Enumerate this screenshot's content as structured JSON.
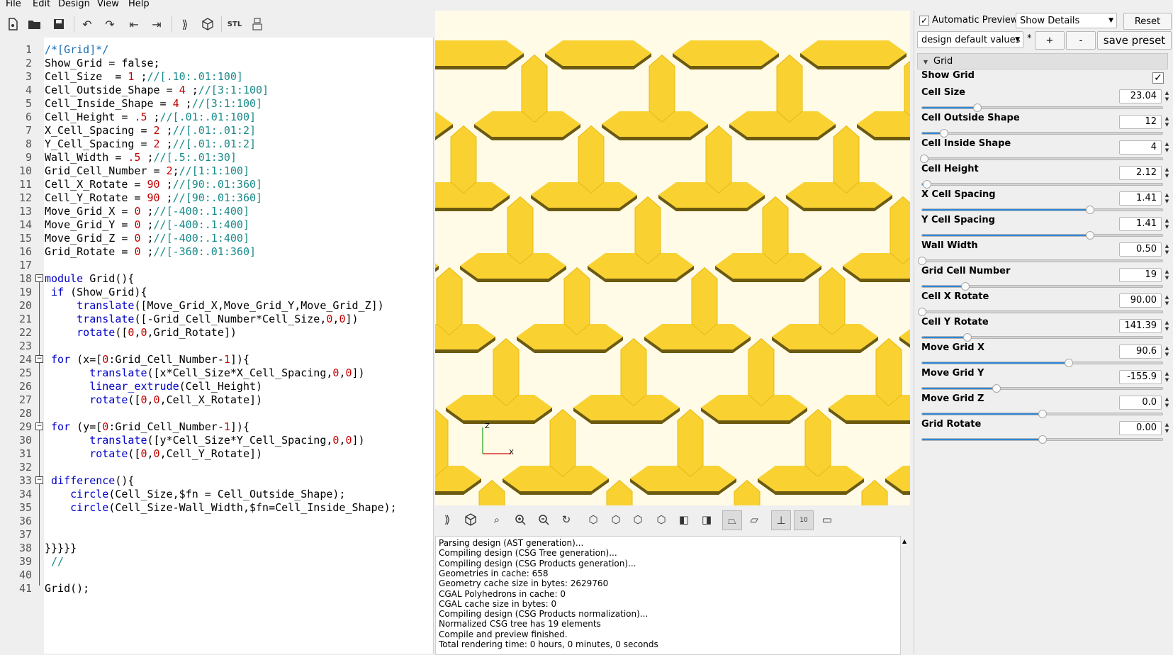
{
  "menubar": {
    "items": [
      "File",
      "Edit",
      "Design",
      "View",
      "Help"
    ]
  },
  "toolbar": {
    "icons": [
      "new-file-icon",
      "open-file-icon",
      "save-icon",
      "undo-icon",
      "redo-icon",
      "unindent-icon",
      "indent-icon",
      "preview-icon",
      "render-icon",
      "export-stl-icon",
      "send-to-print-icon"
    ],
    "stl_label": "STL"
  },
  "editor": {
    "lines": [
      {
        "n": "1",
        "text": "/*[Grid]*/"
      },
      {
        "n": "2",
        "text": "Show_Grid = false;"
      },
      {
        "n": "3",
        "text": "Cell_Size  = 1 ;//[.10:.01:100]"
      },
      {
        "n": "4",
        "text": "Cell_Outside_Shape = 4 ;//[3:1:100]"
      },
      {
        "n": "5",
        "text": "Cell_Inside_Shape = 4 ;//[3:1:100]"
      },
      {
        "n": "6",
        "text": "Cell_Height = .5 ;//[.01:.01:100]"
      },
      {
        "n": "7",
        "text": "X_Cell_Spacing = 2 ;//[.01:.01:2]"
      },
      {
        "n": "8",
        "text": "Y_Cell_Spacing = 2 ;//[.01:.01:2]"
      },
      {
        "n": "9",
        "text": "Wall_Width = .5 ;//[.5:.01:30]"
      },
      {
        "n": "10",
        "text": "Grid_Cell_Number = 2;//[1:1:100]"
      },
      {
        "n": "11",
        "text": "Cell_X_Rotate = 90 ;//[90:.01:360]"
      },
      {
        "n": "12",
        "text": "Cell_Y_Rotate = 90 ;//[90:.01:360]"
      },
      {
        "n": "13",
        "text": "Move_Grid_X = 0 ;//[-400:.1:400]"
      },
      {
        "n": "14",
        "text": "Move_Grid_Y = 0 ;//[-400:.1:400]"
      },
      {
        "n": "15",
        "text": "Move_Grid_Z = 0 ;//[-400:.1:400]"
      },
      {
        "n": "16",
        "text": "Grid_Rotate = 0 ;//[-360:.01:360]"
      },
      {
        "n": "17",
        "text": ""
      },
      {
        "n": "18",
        "text": "module Grid(){"
      },
      {
        "n": "19",
        "text": " if (Show_Grid){"
      },
      {
        "n": "20",
        "text": "     translate([Move_Grid_X,Move_Grid_Y,Move_Grid_Z])"
      },
      {
        "n": "21",
        "text": "     translate([-Grid_Cell_Number*Cell_Size,0,0])"
      },
      {
        "n": "22",
        "text": "     rotate([0,0,Grid_Rotate])"
      },
      {
        "n": "23",
        "text": ""
      },
      {
        "n": "24",
        "text": " for (x=[0:Grid_Cell_Number-1]){"
      },
      {
        "n": "25",
        "text": "       translate([x*Cell_Size*X_Cell_Spacing,0,0])"
      },
      {
        "n": "26",
        "text": "       linear_extrude(Cell_Height)"
      },
      {
        "n": "27",
        "text": "       rotate([0,0,Cell_X_Rotate])"
      },
      {
        "n": "28",
        "text": ""
      },
      {
        "n": "29",
        "text": " for (y=[0:Grid_Cell_Number-1]){"
      },
      {
        "n": "30",
        "text": "       translate([y*Cell_Size*Y_Cell_Spacing,0,0])"
      },
      {
        "n": "31",
        "text": "       rotate([0,0,Cell_Y_Rotate])"
      },
      {
        "n": "32",
        "text": ""
      },
      {
        "n": "33",
        "text": " difference(){"
      },
      {
        "n": "34",
        "text": "    circle(Cell_Size,$fn = Cell_Outside_Shape);"
      },
      {
        "n": "35",
        "text": "    circle(Cell_Size-Wall_Width,$fn=Cell_Inside_Shape);"
      },
      {
        "n": "36",
        "text": ""
      },
      {
        "n": "37",
        "text": ""
      },
      {
        "n": "38",
        "text": "}}}}}"
      },
      {
        "n": "39",
        "text": " //"
      },
      {
        "n": "40",
        "text": ""
      },
      {
        "n": "41",
        "text": "Grid();"
      }
    ]
  },
  "viewport": {
    "axis_labels": {
      "z": "Z",
      "x": "X"
    },
    "cell_color": "#f9d232",
    "background_color": "#fffbe6"
  },
  "view_toolbar": {
    "icons": [
      "preview-icon",
      "render-icon",
      "view-all-icon",
      "zoom-in-icon",
      "zoom-out-icon",
      "reset-view-icon",
      "view-right-icon",
      "view-top-icon",
      "view-bottom-icon",
      "view-left-icon",
      "view-front-icon",
      "view-back-icon",
      "perspective-icon",
      "orthogonal-icon",
      "show-axes-icon",
      "show-scale-markers-icon",
      "show-edges-icon"
    ],
    "scale_label": "10"
  },
  "console": {
    "lines": [
      "Parsing design (AST generation)...",
      "Compiling design (CSG Tree generation)...",
      "Compiling design (CSG Products generation)...",
      "Geometries in cache: 658",
      "Geometry cache size in bytes: 2629760",
      "CGAL Polyhedrons in cache: 0",
      "CGAL cache size in bytes: 0",
      "Compiling design (CSG Products normalization)...",
      "Normalized CSG tree has 19 elements",
      "Compile and preview finished.",
      "Total rendering time: 0 hours, 0 minutes, 0 seconds"
    ]
  },
  "customizer": {
    "auto_preview_label": "Automatic Preview",
    "auto_preview_checked": "✓",
    "details_select": "Show Details",
    "reset_label": "Reset",
    "preset_select": "design default values",
    "preset_modified": "*",
    "add_label": "+",
    "remove_label": "-",
    "save_preset_label": "save preset",
    "group": {
      "arrow": "▼",
      "title": "Grid"
    },
    "show_grid": {
      "label": "Show Grid",
      "checked": "✓"
    },
    "params": [
      {
        "label": "Cell Size",
        "value": "23.04",
        "level": 0.23
      },
      {
        "label": "Cell Outside Shape",
        "value": "12",
        "level": 0.09
      },
      {
        "label": "Cell Inside Shape",
        "value": "4",
        "level": 0.01
      },
      {
        "label": "Cell Height",
        "value": "2.12",
        "level": 0.02
      },
      {
        "label": "X Cell Spacing",
        "value": "1.41",
        "level": 0.7
      },
      {
        "label": "Y Cell Spacing",
        "value": "1.41",
        "level": 0.7
      },
      {
        "label": "Wall Width",
        "value": "0.50",
        "level": 0.0
      },
      {
        "label": "Grid Cell Number",
        "value": "19",
        "level": 0.18
      },
      {
        "label": "Cell X Rotate",
        "value": "90.00",
        "level": 0.0
      },
      {
        "label": "Cell Y Rotate",
        "value": "141.39",
        "level": 0.19
      },
      {
        "label": "Move Grid X",
        "value": "90.6",
        "level": 0.61
      },
      {
        "label": "Move Grid Y",
        "value": "-155.9",
        "level": 0.31
      },
      {
        "label": "Move Grid Z",
        "value": "0.0",
        "level": 0.5
      },
      {
        "label": "Grid Rotate",
        "value": "0.00",
        "level": 0.5
      }
    ]
  }
}
